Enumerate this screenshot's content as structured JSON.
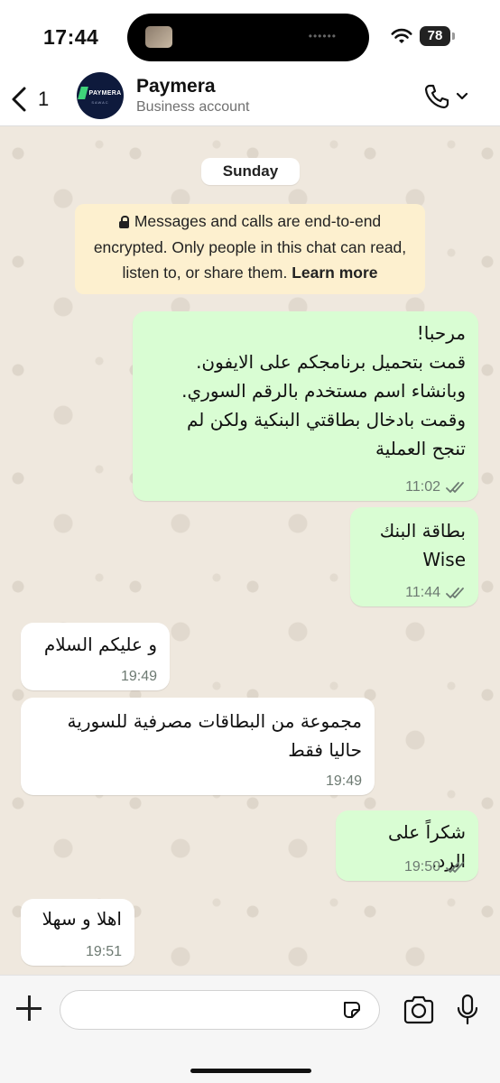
{
  "status_bar": {
    "time": "17:44",
    "battery": "78"
  },
  "header": {
    "back_count": "1",
    "avatar_logo_text": "PAYMERA",
    "avatar_logo_sub": "SAWAC",
    "contact_name": "Paymera",
    "contact_subtitle": "Business account"
  },
  "chat": {
    "date_label": "Sunday",
    "encryption_notice": "Messages and calls are end-to-end encrypted. Only people in this chat can read, listen to, or share them.",
    "encryption_link": "Learn more",
    "messages": [
      {
        "direction": "outgoing",
        "lines": [
          "مرحبا!",
          "قمت بتحميل برنامجكم على الايفون.",
          "وبانشاء اسم مستخدم بالرقم السوري.",
          "وقمت بادخال بطاقتي البنكية ولكن لم",
          "تنجح العملية"
        ],
        "time": "11:02",
        "status": "read"
      },
      {
        "direction": "outgoing",
        "lines": [
          "بطاقة البنك",
          "Wise"
        ],
        "time": "11:44",
        "status": "read"
      },
      {
        "direction": "incoming",
        "lines": [
          "و عليكم السلام"
        ],
        "time": "19:49"
      },
      {
        "direction": "incoming",
        "lines": [
          "مجموعة من البطاقات مصرفية للسورية",
          "حاليا فقط"
        ],
        "time": "19:49"
      },
      {
        "direction": "outgoing",
        "lines": [
          "شكراً على الرد."
        ],
        "time": "19:50",
        "status": "read"
      },
      {
        "direction": "incoming",
        "lines": [
          "اهلا و سهلا"
        ],
        "time": "19:51"
      }
    ]
  },
  "composer": {
    "placeholder": "",
    "value": ""
  },
  "colors": {
    "outgoing_bubble": "#d9fdd3",
    "incoming_bubble": "#ffffff",
    "notice_bg": "#fdf0cf",
    "tick_color": "#6d7a72"
  },
  "icons": [
    "back-chevron-icon",
    "wifi-icon",
    "battery-icon",
    "phone-icon",
    "chevron-down-icon",
    "lock-icon",
    "double-check-icon",
    "plus-icon",
    "sticker-icon",
    "camera-icon",
    "mic-icon"
  ]
}
